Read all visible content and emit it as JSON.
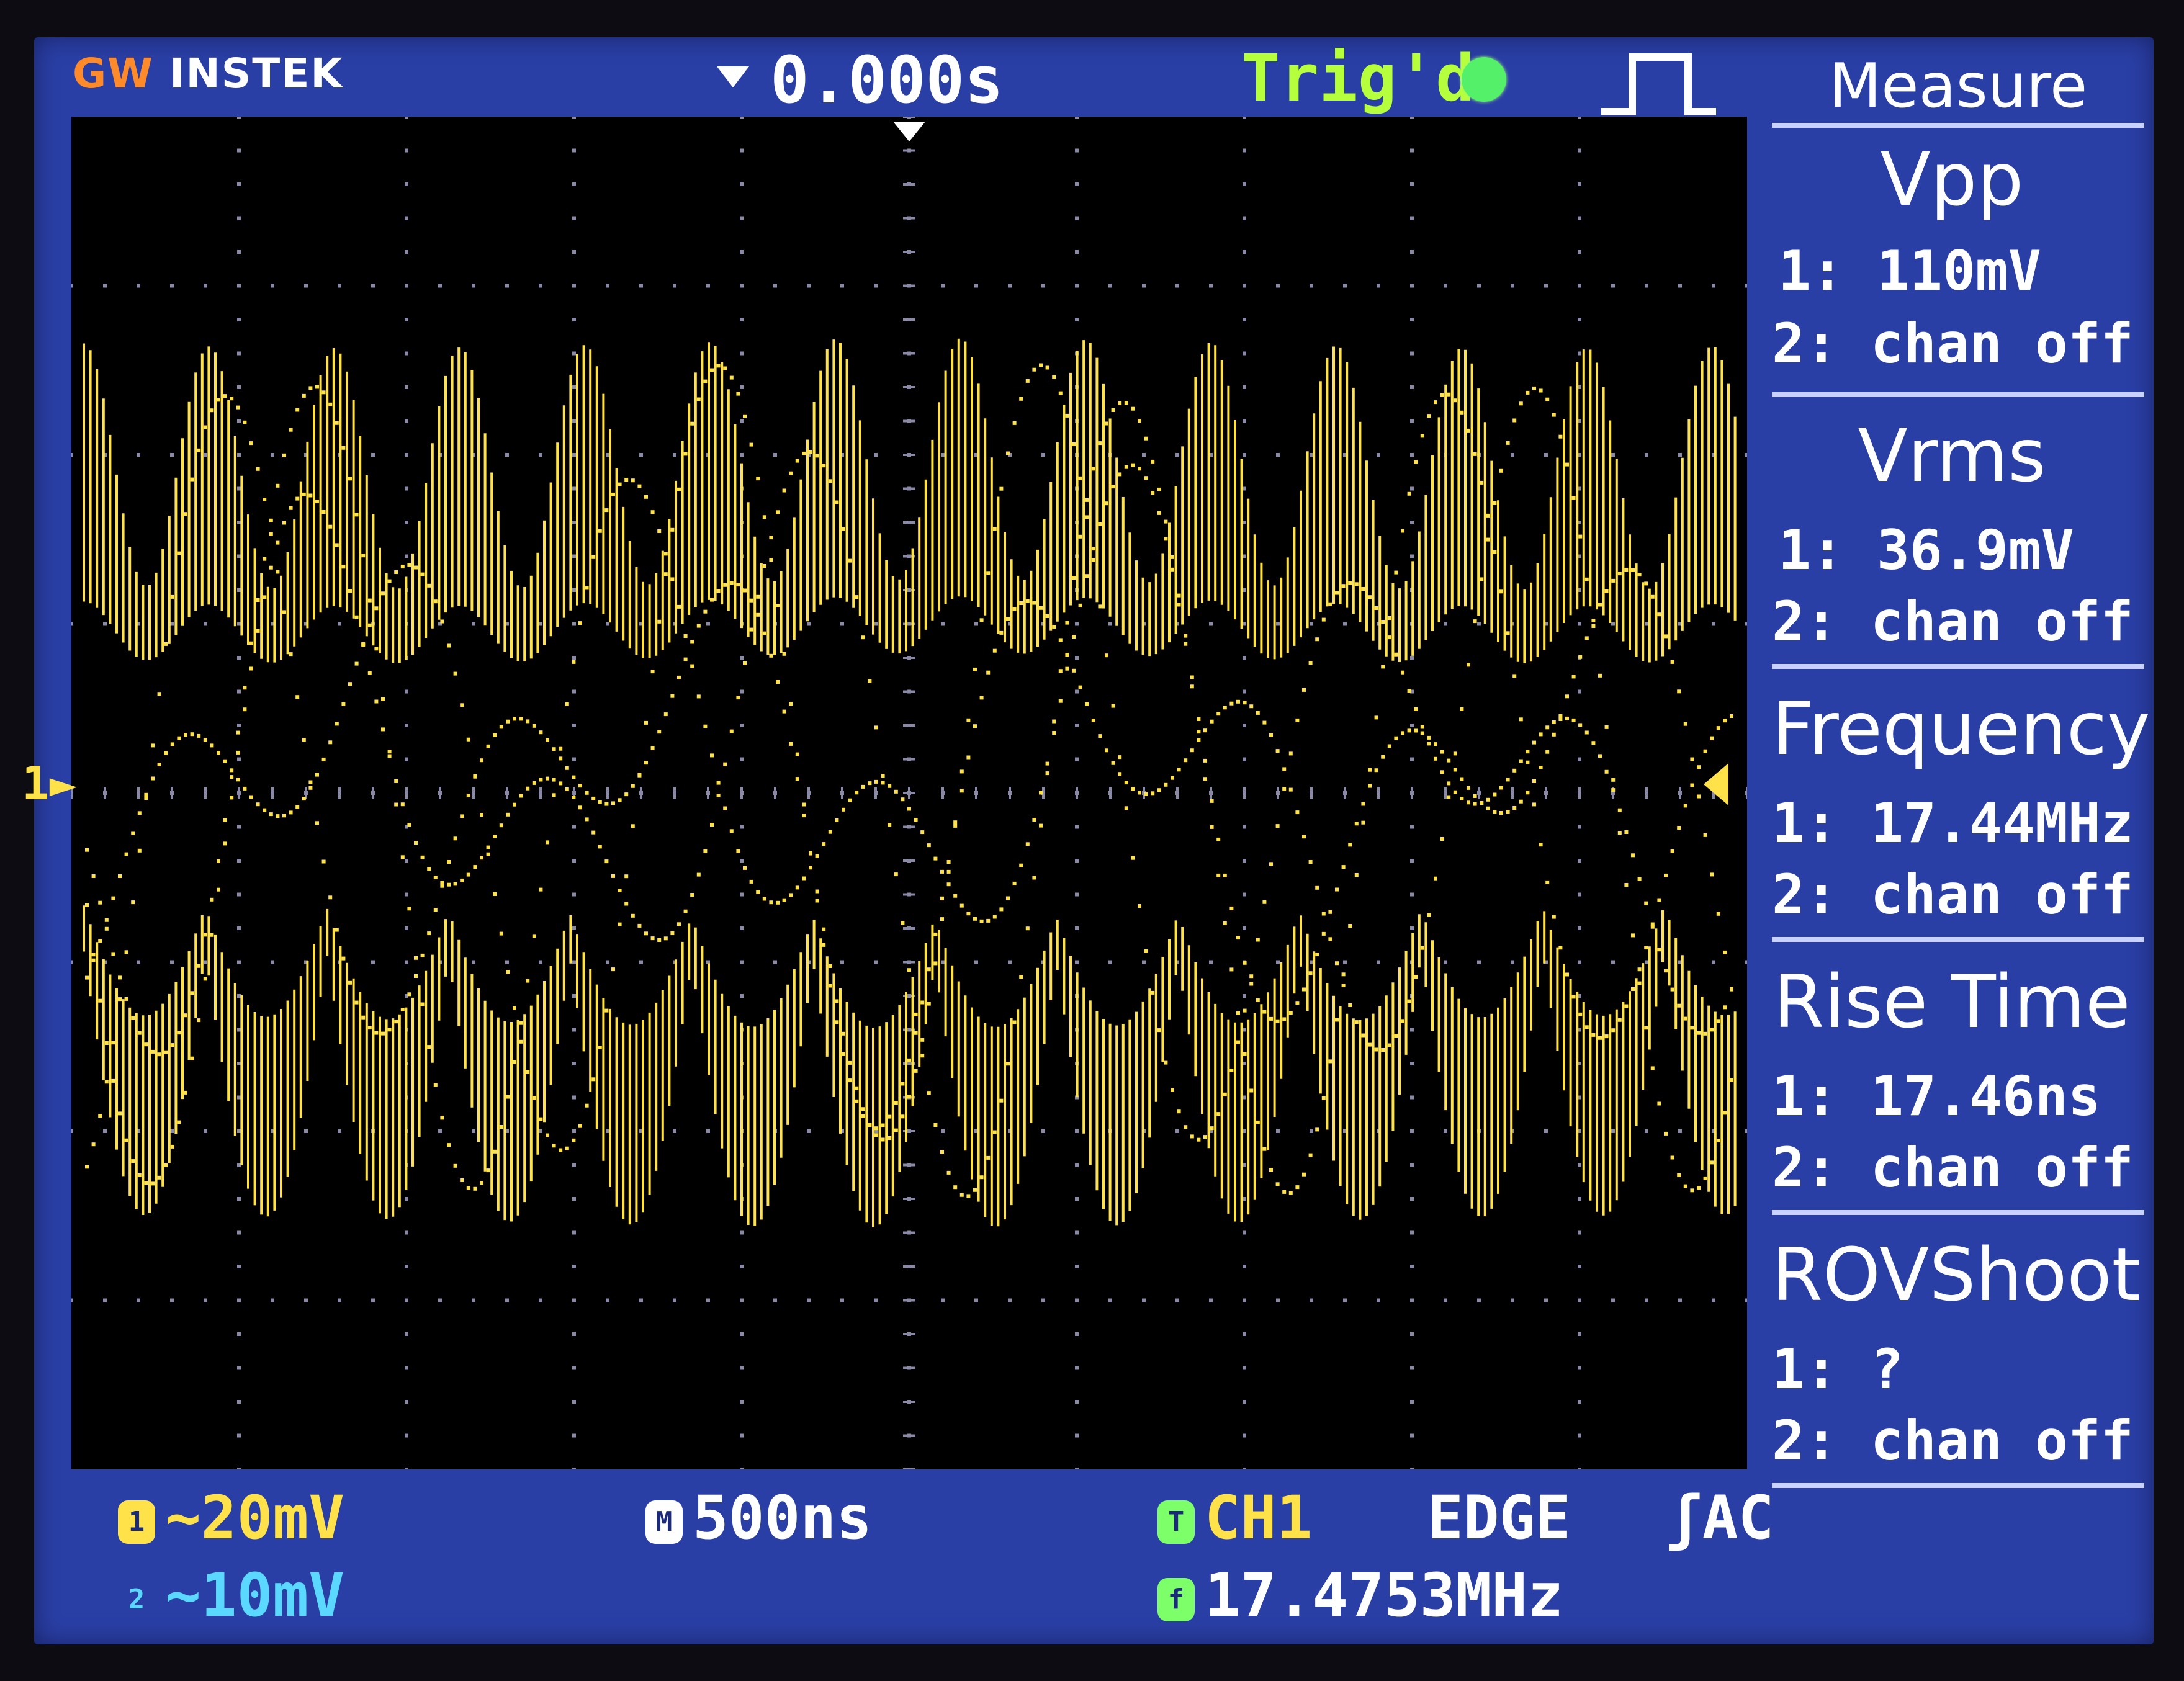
{
  "header": {
    "brand_gw": "GW",
    "brand_instek": "INSTEK",
    "time_offset": "0.000s",
    "trigger_status": "Trig'd"
  },
  "screen": {
    "channel_marker": "1"
  },
  "measure": {
    "title": "Measure",
    "items": [
      {
        "name": "Vpp",
        "ch1": "1: 110mV",
        "ch2": "2: chan off"
      },
      {
        "name": "Vrms",
        "ch1": "1: 36.9mV",
        "ch2": "2: chan off"
      },
      {
        "name": "Frequency",
        "ch1": "1: 17.44MHz",
        "ch2": "2: chan off"
      },
      {
        "name": "Rise Time",
        "ch1": "1: 17.46ns",
        "ch2": "2: chan off"
      },
      {
        "name": "ROVShoot",
        "ch1": "1:    ?",
        "ch2": "2: chan off"
      }
    ]
  },
  "status": {
    "ch1_badge": "1",
    "ch1_scale": "~20mV",
    "ch2_badge": "2",
    "ch2_scale": "~10mV",
    "timebase_badge": "M",
    "timebase": "500ns",
    "trigger_badge": "T",
    "trigger_source": "CH1",
    "trigger_type": "EDGE",
    "trigger_slope_coupling": "ʃAC",
    "freq_badge": "f",
    "trigger_frequency": "17.4753MHz"
  },
  "colors": {
    "ch1": "#ffe14a",
    "ch2": "#5ad8ff",
    "trig_ok": "#b6ff3c",
    "panel": "#2a3fa6",
    "grid": "#8a8aa8"
  }
}
